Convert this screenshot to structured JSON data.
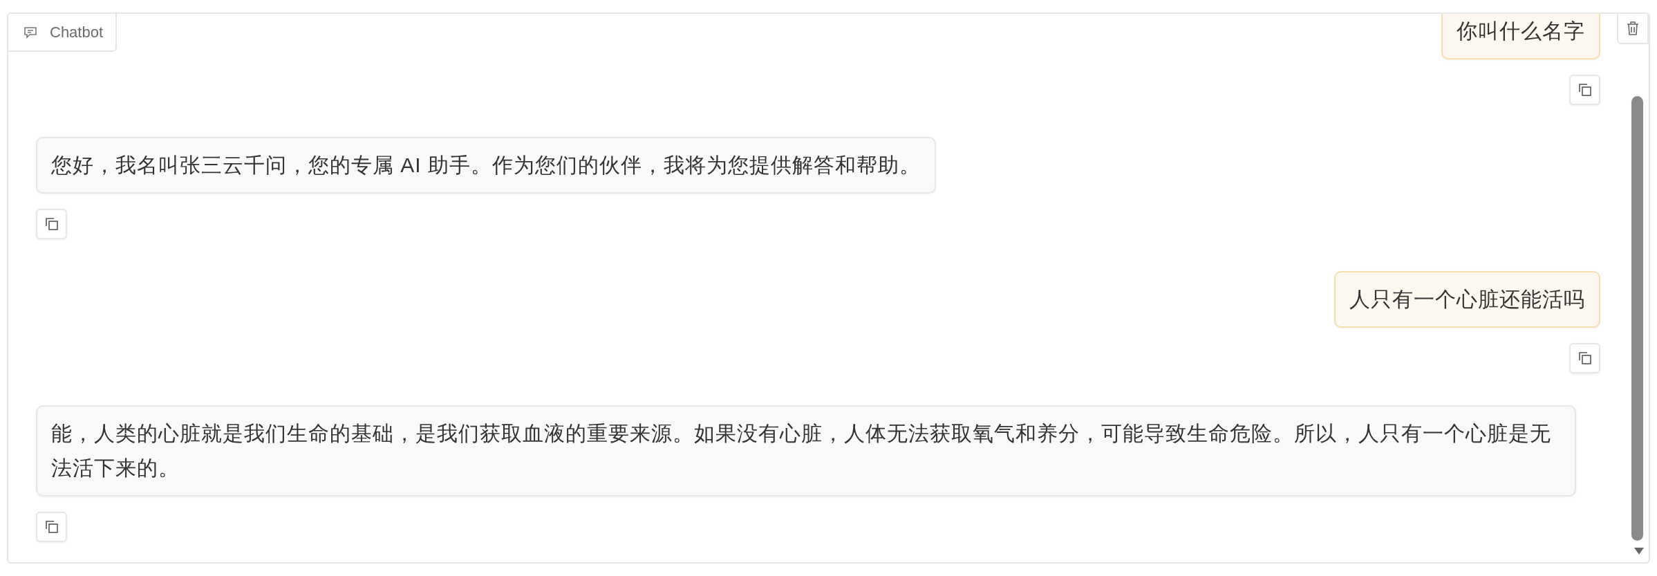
{
  "panel": {
    "label": "Chatbot"
  },
  "messages": [
    {
      "kind": "user",
      "text": "你叫什么名字"
    },
    {
      "kind": "bot",
      "text": "您好，我名叫张三云千问，您的专属 AI 助手。作为您们的伙伴，我将为您提供解答和帮助。"
    },
    {
      "kind": "user",
      "text": "人只有一个心脏还能活吗"
    },
    {
      "kind": "bot",
      "text": "能，人类的心脏就是我们生命的基础，是我们获取血液的重要来源。如果没有心脏，人体无法获取氧气和养分，可能导致生命危险。所以，人只有一个心脏是无法活下来的。"
    }
  ]
}
